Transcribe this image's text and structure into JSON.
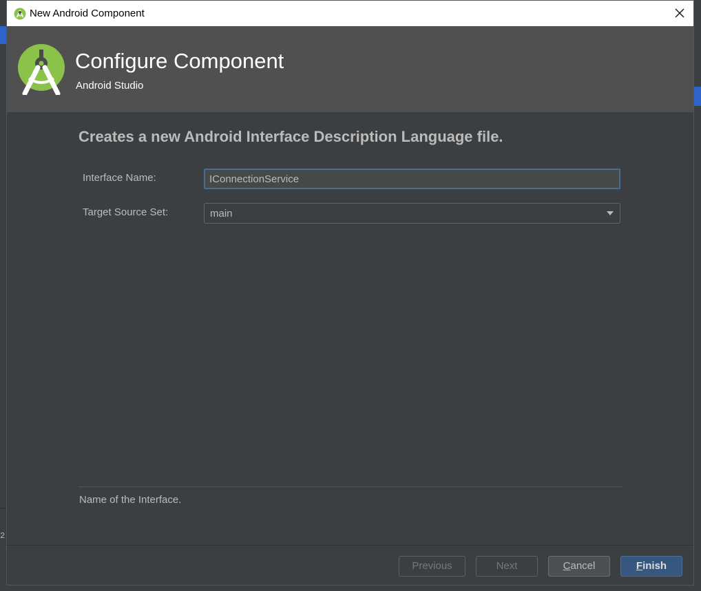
{
  "window": {
    "title": "New Android Component",
    "icon": "android-studio-icon",
    "close_icon": "close-icon"
  },
  "header": {
    "title": "Configure Component",
    "subtitle": "Android Studio",
    "logo": "android-studio-logo"
  },
  "description": "Creates a new Android Interface Description Language file.",
  "form": {
    "interface_name": {
      "label": "Interface Name:",
      "value": "IConnectionService"
    },
    "target_source_set": {
      "label": "Target Source Set:",
      "value": "main"
    }
  },
  "help_text": "Name of the Interface.",
  "buttons": {
    "previous": {
      "label": "Previous",
      "enabled": false
    },
    "next": {
      "label": "Next",
      "enabled": false
    },
    "cancel": {
      "label": "Cancel",
      "mnemonic": "C",
      "rest": "ancel"
    },
    "finish": {
      "label": "Finish",
      "mnemonic": "F",
      "rest": "inish"
    }
  },
  "background_ide": {
    "gutter_digit": "2"
  },
  "colors": {
    "dialog_bg": "#3c3f41",
    "header_bg": "#505050",
    "accent": "#365880",
    "focus_border": "#466d94",
    "android_green": "#8bc34a"
  }
}
